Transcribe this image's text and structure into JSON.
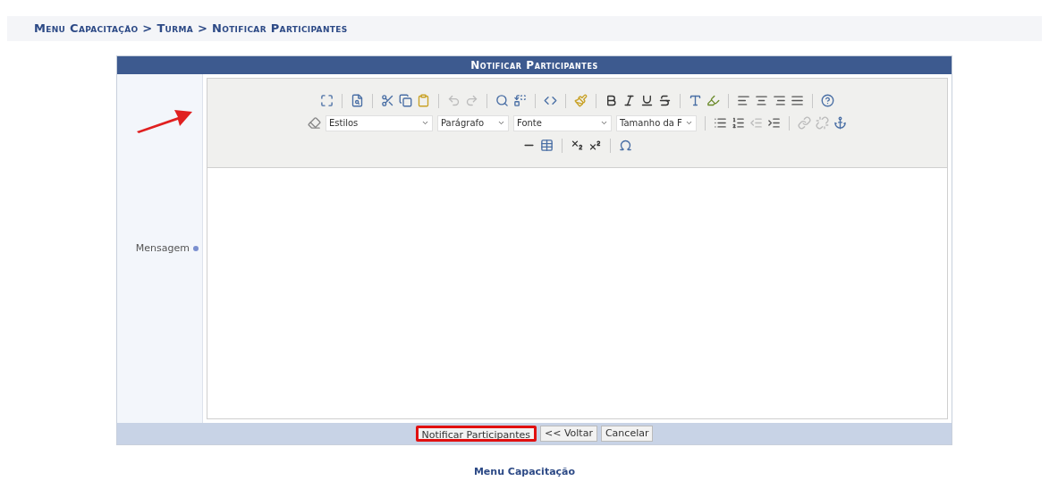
{
  "breadcrumb": "Menu Capacitação > Turma > Notificar Participantes",
  "form": {
    "title": "Notificar Participantes",
    "field": {
      "label": "Mensagem",
      "required": true,
      "annotated": true
    },
    "editor": {
      "dropdowns": [
        "Estilos",
        "Parágrafo",
        "Fonte",
        "Tamanho da F"
      ]
    },
    "buttons": [
      {
        "label": "Notificar Participantes",
        "highlighted": true
      },
      {
        "label": "<< Voltar",
        "highlighted": false
      },
      {
        "label": "Cancelar",
        "highlighted": false
      }
    ]
  },
  "footer_link": "Menu Capacitação"
}
